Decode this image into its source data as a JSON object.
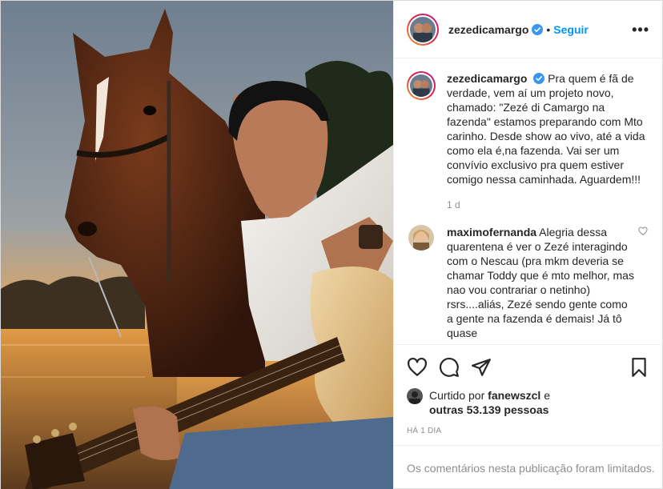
{
  "header": {
    "username": "zezedicamargo",
    "separator": "•",
    "follow_label": "Seguir",
    "more_label": "•••"
  },
  "caption": {
    "username": "zezedicamargo",
    "text": "Pra quem é fã de verdade, vem aí um projeto novo, chamado: \"Zezé di Camargo na fazenda\" estamos preparando com Mto carinho. Desde show ao vivo, até a vida como ela é,na fazenda. Vai ser um convívio exclusivo pra quem estiver comigo nessa caminhada. Aguardem!!!",
    "time": "1 d"
  },
  "comments": [
    {
      "username": "maximofernanda",
      "text": "Alegria dessa quarentena é ver o Zezé interagindo com o Nescau (pra mkm deveria se chamar Toddy que é mto melhor, mas nao vou contrariar o netinho) rsrs....aliás, Zezé sendo gente como a gente na fazenda é demais! Já tô quase"
    }
  ],
  "likes": {
    "prefix": "Curtido por",
    "user": "fanewszcl",
    "connector": "e",
    "others": "outras 53.139 pessoas"
  },
  "post_time": "HÁ 1 DIA",
  "comments_limited": "Os comentários nesta publicação foram limitados.",
  "icons": [
    "verified-badge",
    "heart-icon",
    "comment-icon",
    "share-icon",
    "bookmark-icon",
    "more-icon"
  ],
  "colors": {
    "accent": "#0095f6",
    "verified": "#3897f0",
    "muted": "#8e8e8e"
  }
}
